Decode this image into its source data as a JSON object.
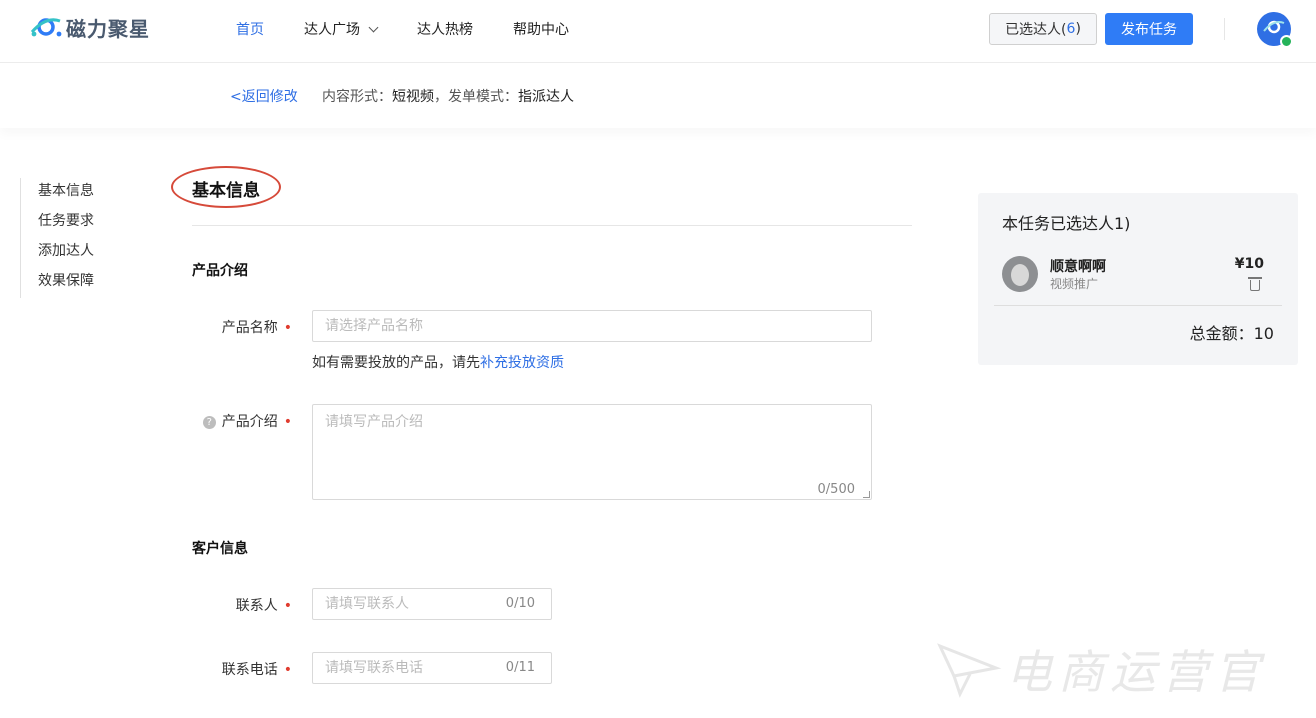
{
  "brand": {
    "name": "磁力聚星"
  },
  "nav": [
    {
      "label": "首页",
      "active": true
    },
    {
      "label": "达人广场",
      "dropdown": true
    },
    {
      "label": "达人热榜"
    },
    {
      "label": "帮助中心"
    }
  ],
  "header_actions": {
    "selected_label": "已选达人(",
    "selected_count": "6",
    "selected_suffix": ")",
    "publish_label": "发布任务"
  },
  "subbar": {
    "back_label": "返回修改",
    "content_form_label": "内容形式：",
    "content_form_value": "短视频",
    "separator": "，",
    "order_mode_label": "发单模式：",
    "order_mode_value": "指派达人"
  },
  "sidenav": [
    "基本信息",
    "任务要求",
    "添加达人",
    "效果保障"
  ],
  "form": {
    "section_title": "基本信息",
    "product_group": "产品介绍",
    "product_name_label": "产品名称",
    "product_name_placeholder": "请选择产品名称",
    "hint_prefix": "如有需要投放的产品，请先",
    "hint_link": "补充投放资质",
    "product_intro_label": "产品介绍",
    "product_intro_placeholder": "请填写产品介绍",
    "product_intro_count": "0/500",
    "customer_group": "客户信息",
    "contact_label": "联系人",
    "contact_placeholder": "请填写联系人",
    "contact_count": "0/10",
    "phone_label": "联系电话",
    "phone_placeholder": "请填写联系电话",
    "phone_count": "0/11"
  },
  "panel": {
    "title": "本任务已选达人1)",
    "creator_name": "顺意啊啊",
    "creator_type": "视频推广",
    "creator_price": "¥10",
    "total": "总金额：10"
  },
  "watermark": {
    "text": "电商运营官"
  },
  "colors": {
    "accent": "#2f7cf6",
    "required": "#e03c2f",
    "annotation": "#d64a3a"
  }
}
